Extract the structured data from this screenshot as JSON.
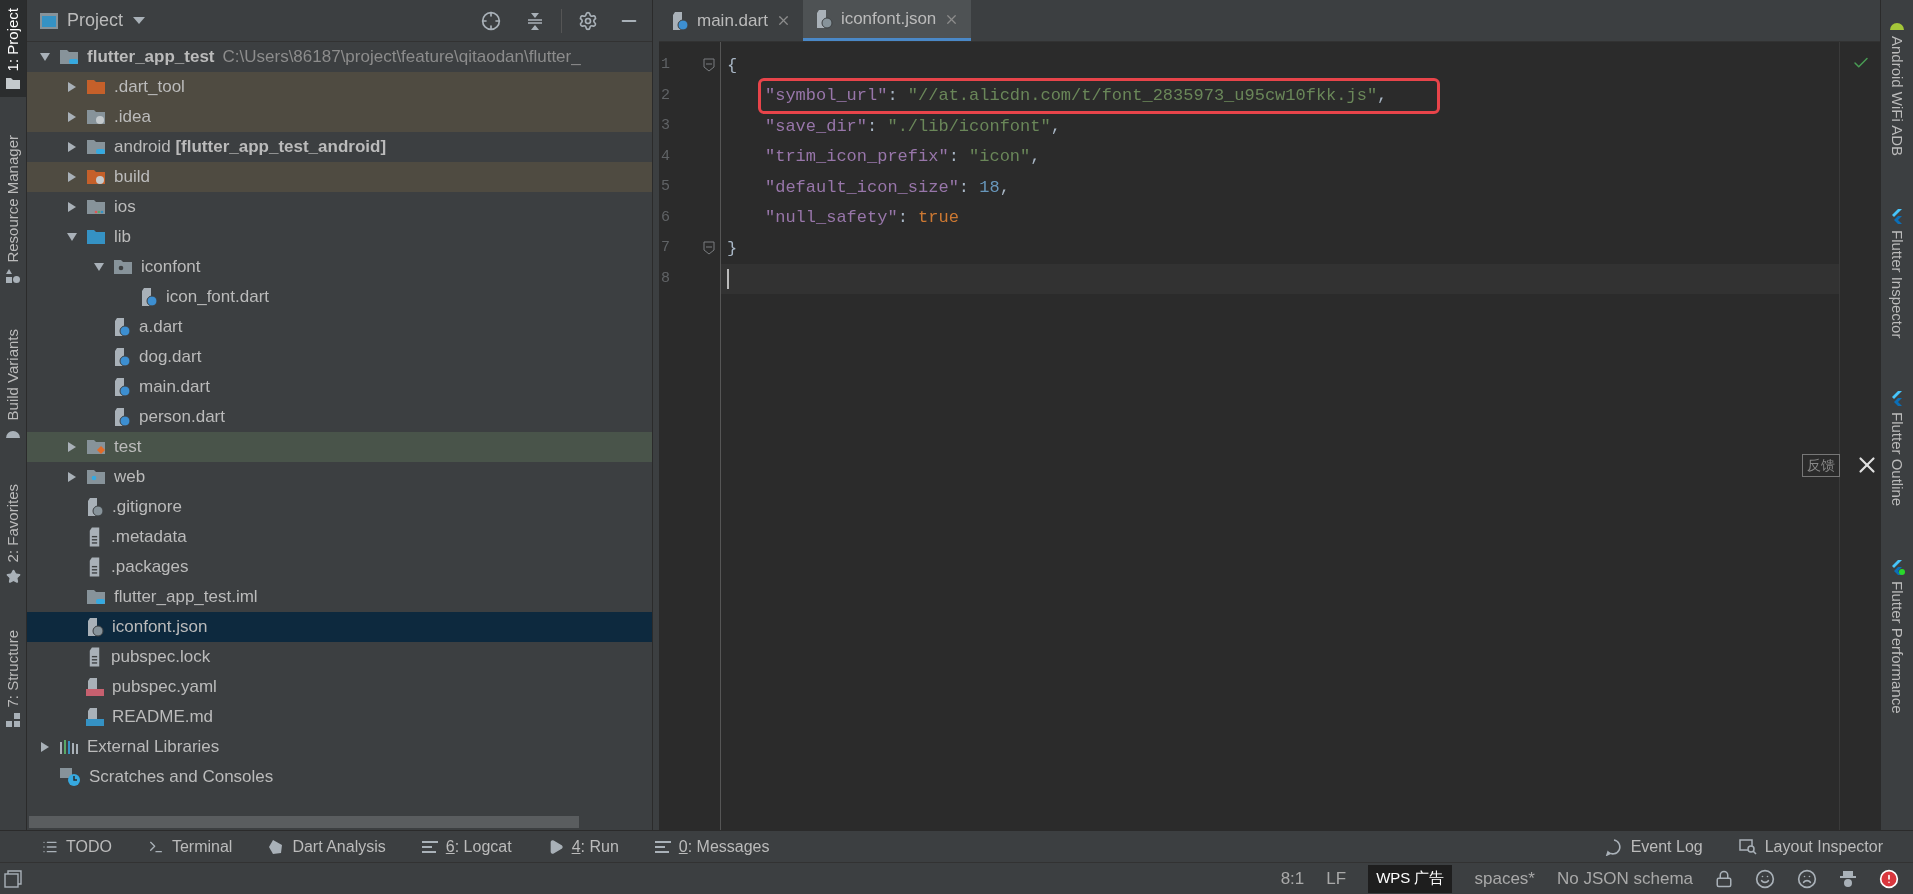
{
  "left_tool_windows": [
    {
      "label": "1: Project",
      "selected": true
    },
    {
      "label": "Resource Manager",
      "selected": false
    },
    {
      "label": "Build Variants",
      "selected": false
    },
    {
      "label": "2: Favorites",
      "selected": false
    },
    {
      "label": "7: Structure",
      "selected": false
    }
  ],
  "project_panel": {
    "title": "Project",
    "root": {
      "name": "flutter_app_test",
      "path": "C:\\Users\\86187\\project\\feature\\qitaodan\\flutter_",
      "expanded": true,
      "selected": false,
      "children": [
        {
          "label": ".dart_tool",
          "kind": "folder-excluded",
          "expanded": false,
          "selected": false,
          "color": "#4f4b41"
        },
        {
          "label": ".idea",
          "kind": "folder-config",
          "expanded": false,
          "selected": false,
          "color": "#4f4b41"
        },
        {
          "label": "android **[flutter_app_test_android]**",
          "kind": "folder-module",
          "expanded": false,
          "selected": false
        },
        {
          "label": "build",
          "kind": "folder-build",
          "expanded": false,
          "selected": false,
          "color": "#4f4b41"
        },
        {
          "label": "ios",
          "kind": "folder-ios",
          "expanded": false,
          "selected": false
        },
        {
          "label": "lib",
          "kind": "folder-source",
          "expanded": true,
          "selected": false,
          "children": [
            {
              "label": "iconfont",
              "kind": "folder-package",
              "expanded": true,
              "selected": false,
              "children": [
                {
                  "label": "icon_font.dart",
                  "kind": "file-dart",
                  "selected": false
                }
              ]
            },
            {
              "label": "a.dart",
              "kind": "file-dart",
              "selected": false
            },
            {
              "label": "dog.dart",
              "kind": "file-dart",
              "selected": false
            },
            {
              "label": "main.dart",
              "kind": "file-dart",
              "selected": false
            },
            {
              "label": "person.dart",
              "kind": "file-dart",
              "selected": false
            }
          ]
        },
        {
          "label": "test",
          "kind": "folder-test",
          "expanded": false,
          "selected": false,
          "color": "#49544a"
        },
        {
          "label": "web",
          "kind": "folder-web",
          "expanded": false,
          "selected": false
        },
        {
          "label": ".gitignore",
          "kind": "file-ignore",
          "selected": false
        },
        {
          "label": ".metadata",
          "kind": "file-text",
          "selected": false
        },
        {
          "label": ".packages",
          "kind": "file-text",
          "selected": false
        },
        {
          "label": "flutter_app_test.iml",
          "kind": "folder-module",
          "selected": false
        },
        {
          "label": "iconfont.json",
          "kind": "file-json",
          "selected": true
        },
        {
          "label": "pubspec.lock",
          "kind": "file-text",
          "selected": false
        },
        {
          "label": "pubspec.yaml",
          "kind": "file-yaml",
          "selected": false
        },
        {
          "label": "README.md",
          "kind": "file-md",
          "selected": false
        }
      ]
    },
    "extra": [
      {
        "label": "External Libraries",
        "kind": "libraries",
        "expanded": false
      },
      {
        "label": "Scratches and Consoles",
        "kind": "scratches"
      }
    ]
  },
  "editor_tabs": [
    {
      "label": "main.dart",
      "kind": "file-dart",
      "selected": false
    },
    {
      "label": "iconfont.json",
      "kind": "file-json",
      "selected": true
    }
  ],
  "code_lines": [
    {
      "number": "1",
      "fold": true,
      "tokens": [
        {
          "kind": "punct",
          "text": "{"
        }
      ]
    },
    {
      "number": "2",
      "boxed": true,
      "tokens": [
        {
          "kind": "key",
          "text": "\"symbol_url\""
        },
        {
          "kind": "punct",
          "text": ": "
        },
        {
          "kind": "string",
          "text": "\"//at.alicdn.com/t/font_2835973_u95cw10fkk.js\""
        },
        {
          "kind": "punct",
          "text": ","
        }
      ]
    },
    {
      "number": "3",
      "tokens": [
        {
          "kind": "key",
          "text": "\"save_dir\""
        },
        {
          "kind": "punct",
          "text": ": "
        },
        {
          "kind": "string",
          "text": "\"./lib/iconfont\""
        },
        {
          "kind": "punct",
          "text": ","
        }
      ]
    },
    {
      "number": "4",
      "tokens": [
        {
          "kind": "key",
          "text": "\"trim_icon_prefix\""
        },
        {
          "kind": "punct",
          "text": ": "
        },
        {
          "kind": "string",
          "text": "\"icon\""
        },
        {
          "kind": "punct",
          "text": ","
        }
      ]
    },
    {
      "number": "5",
      "tokens": [
        {
          "kind": "key",
          "text": "\"default_icon_size\""
        },
        {
          "kind": "punct",
          "text": ": "
        },
        {
          "kind": "number",
          "text": "18"
        },
        {
          "kind": "punct",
          "text": ","
        }
      ]
    },
    {
      "number": "6",
      "tokens": [
        {
          "kind": "key",
          "text": "\"null_safety\""
        },
        {
          "kind": "punct",
          "text": ": "
        },
        {
          "kind": "keyword",
          "text": "true"
        }
      ]
    },
    {
      "number": "7",
      "fold": true,
      "tokens": [
        {
          "kind": "punct",
          "text": "}"
        }
      ]
    },
    {
      "number": "8",
      "current": true
    }
  ],
  "right_tool_windows": [
    {
      "label": "Android WiFi ADB"
    },
    {
      "label": "Flutter Inspector"
    },
    {
      "label": "Flutter Outline"
    },
    {
      "label": "Flutter Performance"
    }
  ],
  "feedback_popup": {
    "label": "反馈"
  },
  "bottom_tools": [
    {
      "label": "TODO"
    },
    {
      "label": "Terminal"
    },
    {
      "label": "Dart Analysis"
    },
    {
      "key": "6",
      "label": ": Logcat"
    },
    {
      "key": "4",
      "label": ": Run"
    },
    {
      "key": "0",
      "label": ": Messages"
    }
  ],
  "bottom_tools_right": [
    {
      "label": "Event Log"
    },
    {
      "label": "Layout Inspector"
    }
  ],
  "status_bar": {
    "items": [
      "8:1",
      "LF"
    ],
    "ad_label": "WPS 广告",
    "items_after": [
      "spaces*",
      "No JSON schema"
    ]
  }
}
